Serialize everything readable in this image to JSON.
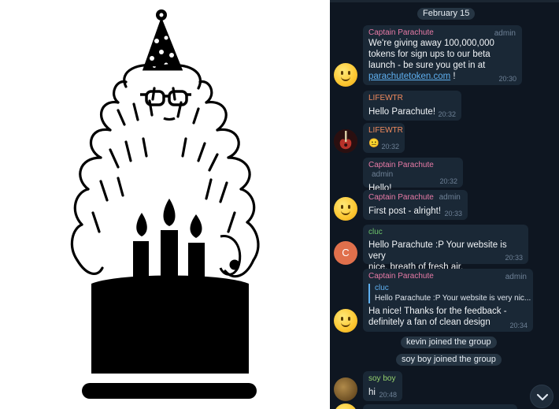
{
  "date_label": "February 15",
  "colors": {
    "chat_bg": "#0e1621",
    "bubble_bg": "#1a2836",
    "name_captain": "#e77aa6",
    "name_lifewtr": "#f08a5d",
    "name_cluc": "#6cc36a",
    "name_soyboy": "#95d16d",
    "link": "#5fb0f0"
  },
  "messages": [
    {
      "sender": "Captain Parachute",
      "badge": "admin",
      "lines": [
        "We're giving away 100,000,000",
        "tokens for sign ups to our beta",
        "launch - be sure you get in at"
      ],
      "link": "parachutetoken.com",
      "link_suffix": " !",
      "time": "20:30",
      "avatar": "smiley-emoji"
    },
    {
      "sender": "LIFEWTR",
      "text": "Hello Parachute!",
      "time": "20:32"
    },
    {
      "sender": "LIFEWTR",
      "text": "😐",
      "time": "20:32",
      "avatar": "guitar-photo"
    },
    {
      "sender": "Captain Parachute",
      "badge": "admin",
      "text": "Hello!",
      "time": "20:32"
    },
    {
      "sender": "Captain Parachute",
      "badge": "admin",
      "text": "First post - alright!",
      "time": "20:33",
      "avatar": "smiley-emoji"
    },
    {
      "sender": "cluc",
      "lines": [
        "Hello Parachute :P Your website is very",
        "nice, breath of fresh air."
      ],
      "time": "20:33",
      "avatar_letter": "C"
    },
    {
      "sender": "Captain Parachute",
      "badge": "admin",
      "reply_name": "cluc",
      "reply_text": "Hello Parachute :P Your website is very nic...",
      "lines": [
        "Ha nice! Thanks for the feedback -",
        "definitely a fan of clean design"
      ],
      "time": "20:34",
      "avatar": "smiley-emoji"
    },
    {
      "sender": "soy boy",
      "text": "hi",
      "time": "20:48",
      "avatar": "texture-photo"
    }
  ],
  "service": [
    "kevin joined the group",
    "soy boy joined the group"
  ],
  "scroll_button_icon": "chevron-down-icon"
}
